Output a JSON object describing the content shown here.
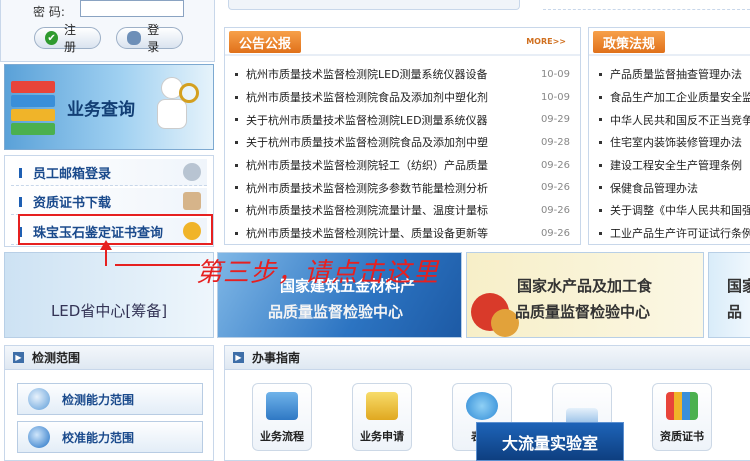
{
  "login": {
    "password_label": "密 码:",
    "register_label": "注 册",
    "login_label": "登 录"
  },
  "biz_banner": {
    "title": "业务查询"
  },
  "quick_links": [
    {
      "label": "员工邮箱登录",
      "icon": "people-icon"
    },
    {
      "label": "资质证书下载",
      "icon": "clipboard-icon"
    },
    {
      "label": "珠宝玉石鉴定证书查询",
      "icon": "award-ribbon-icon"
    }
  ],
  "annotation": {
    "text": "第三步，请点击这里",
    "color": "#e62020"
  },
  "notice": {
    "tab_label": "公告公报",
    "more_label": "MORE>>",
    "items": [
      {
        "title": "杭州市质量技术监督检测院LED测量系统仪器设备",
        "date": "10-09"
      },
      {
        "title": "杭州市质量技术监督检测院食品及添加剂中塑化剂",
        "date": "10-09"
      },
      {
        "title": "关于杭州市质量技术监督检测院LED测量系统仪器",
        "date": "09-29"
      },
      {
        "title": "关于杭州市质量技术监督检测院食品及添加剂中塑",
        "date": "09-28"
      },
      {
        "title": "杭州市质量技术监督检测院轻工（纺织）产品质量",
        "date": "09-26"
      },
      {
        "title": "杭州市质量技术监督检测院多参数节能量检测分析",
        "date": "09-26"
      },
      {
        "title": "杭州市质量技术监督检测院流量计量、温度计量标",
        "date": "09-26"
      },
      {
        "title": "杭州市质量技术监督检测院计量、质量设备更新等",
        "date": "09-26"
      }
    ]
  },
  "policy": {
    "tab_label": "政策法规",
    "items": [
      "产品质量监督抽查管理办法",
      "食品生产加工企业质量安全监",
      "中华人民共和国反不正当竞争",
      "住宅室内装饰装修管理办法",
      "建设工程安全生产管理条例",
      "保健食品管理办法",
      "关于调整《中华人民共和国强",
      "工业产品生产许可证试行条例"
    ]
  },
  "banners": {
    "led": "LED省中心[筹备]",
    "build_line1": "国家建筑五金材料产",
    "build_line2": "品质量监督检验中心",
    "aqua_line1": "国家水产品及加工食",
    "aqua_line2": "品质量监督检验中心",
    "nat_line1": "国家",
    "nat_line2": "品"
  },
  "scope": {
    "title": "检测范围",
    "items": [
      {
        "label": "检测能力范围",
        "icon": "magnifier-icon"
      },
      {
        "label": "校准能力范围",
        "icon": "flask-icon"
      }
    ]
  },
  "guide": {
    "title": "办事指南",
    "items": [
      {
        "label": "业务流程",
        "icon": "flowchart-icon"
      },
      {
        "label": "业务申请",
        "icon": "application-icon"
      },
      {
        "label": "表格",
        "icon": "globe-icon"
      },
      {
        "label": "",
        "icon": "monitor-icon"
      },
      {
        "label": "资质证书",
        "icon": "books-icon"
      }
    ],
    "lab_banner": "大流量实验室"
  }
}
